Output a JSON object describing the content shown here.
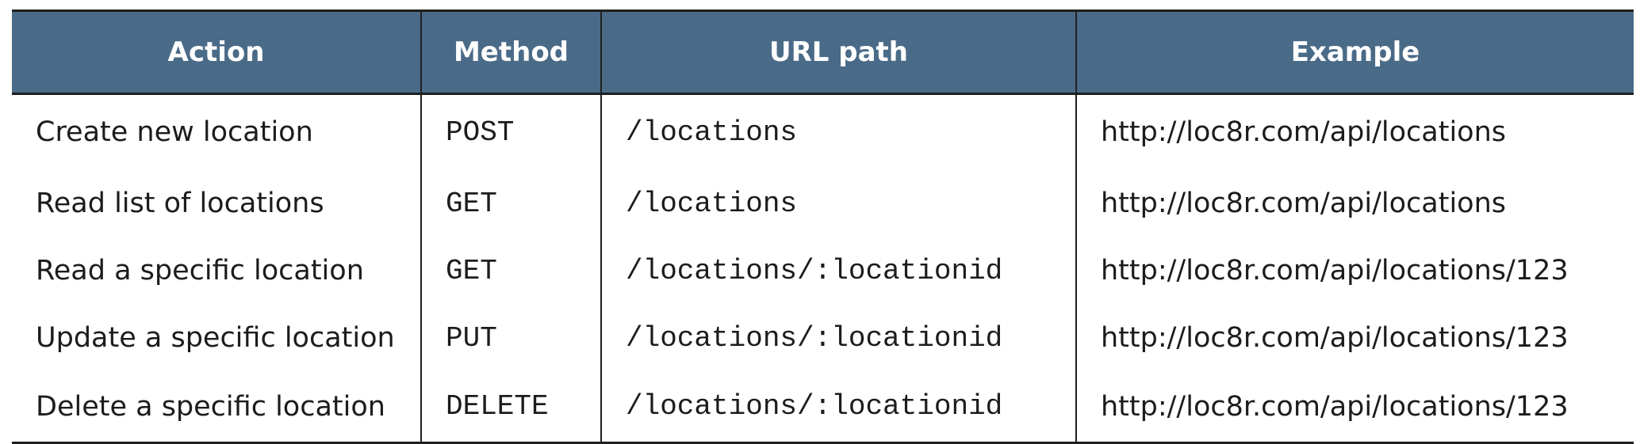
{
  "table": {
    "headers": {
      "action": "Action",
      "method": "Method",
      "url_path": "URL path",
      "example": "Example"
    },
    "rows": [
      {
        "action": "Create new location",
        "method": "POST",
        "url_path": "/locations",
        "example": "http://loc8r.com/api/locations"
      },
      {
        "action": "Read list of locations",
        "method": "GET",
        "url_path": "/locations",
        "example": "http://loc8r.com/api/locations"
      },
      {
        "action": "Read a specific location",
        "method": "GET",
        "url_path": "/locations/:locationid",
        "example": "http://loc8r.com/api/locations/123"
      },
      {
        "action": "Update a specific location",
        "method": "PUT",
        "url_path": "/locations/:locationid",
        "example": "http://loc8r.com/api/locations/123"
      },
      {
        "action": "Delete a specific location",
        "method": "DELETE",
        "url_path": "/locations/:locationid",
        "example": "http://loc8r.com/api/locations/123"
      }
    ]
  },
  "colors": {
    "header_background": "#4a6b88",
    "header_text": "#ffffff",
    "body_text": "#1c1c1c",
    "rule": "#1f1f1f"
  }
}
